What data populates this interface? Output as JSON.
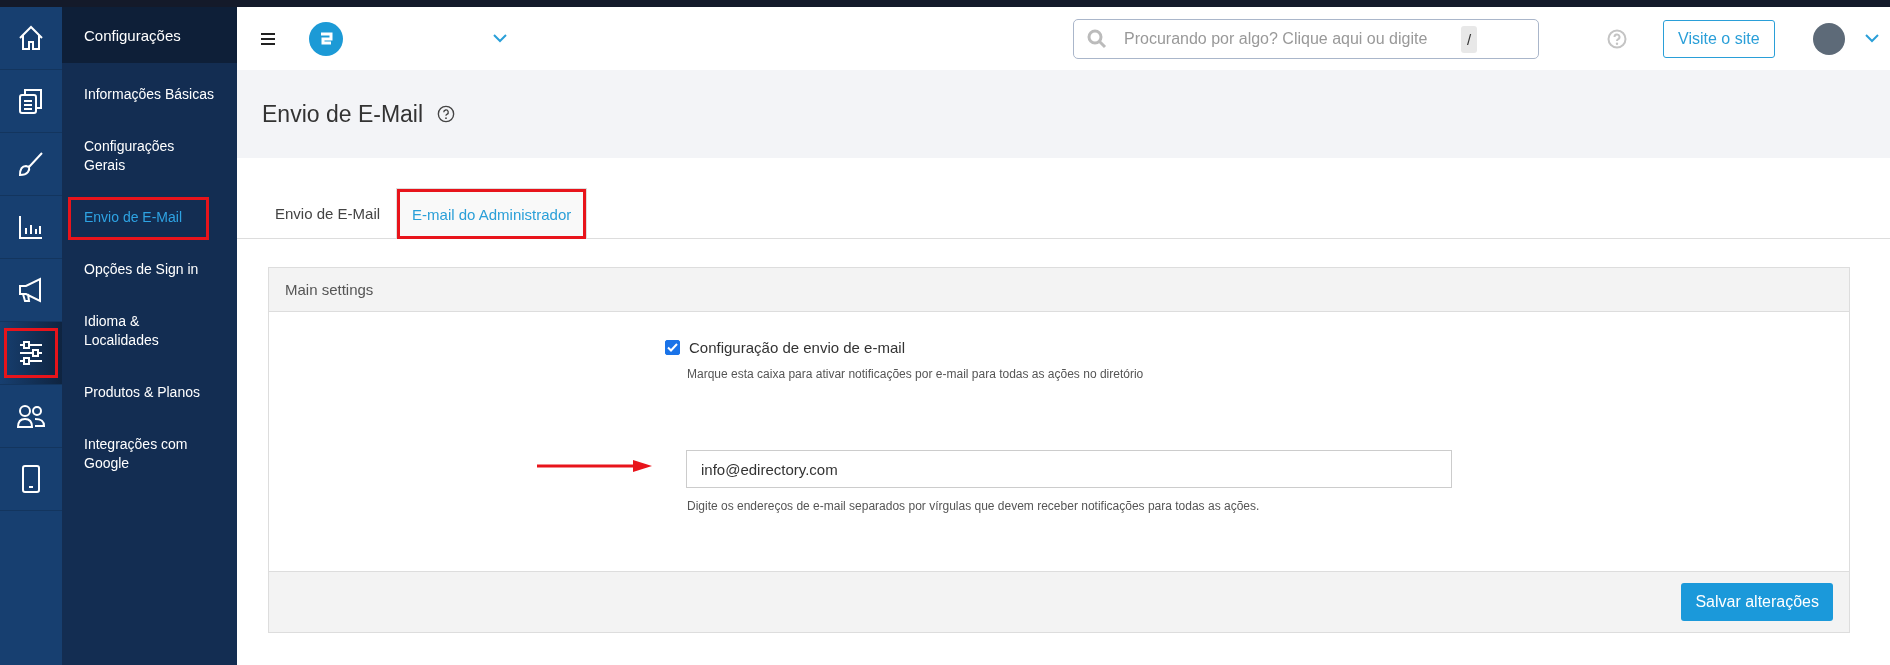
{
  "rail": [
    {
      "kind": "home",
      "selected": false,
      "highlighted": false
    },
    {
      "kind": "pages",
      "selected": false,
      "highlighted": false
    },
    {
      "kind": "brush",
      "selected": false,
      "highlighted": false
    },
    {
      "kind": "chart",
      "selected": false,
      "highlighted": false
    },
    {
      "kind": "megaphone",
      "selected": false,
      "highlighted": false
    },
    {
      "kind": "sliders",
      "selected": true,
      "highlighted": true
    },
    {
      "kind": "users",
      "selected": false,
      "highlighted": false
    },
    {
      "kind": "phone",
      "selected": false,
      "highlighted": false
    }
  ],
  "sidebar": {
    "title": "Configurações",
    "items": [
      {
        "label": "Informações Básicas",
        "selected": false,
        "highlighted": false
      },
      {
        "label": "Configurações Gerais",
        "selected": false,
        "highlighted": false
      },
      {
        "label": "Envio de E-Mail",
        "selected": true,
        "highlighted": true
      },
      {
        "label": "Opções de Sign in",
        "selected": false,
        "highlighted": false
      },
      {
        "label": "Idioma & Localidades",
        "selected": false,
        "highlighted": false
      },
      {
        "label": "Produtos & Planos",
        "selected": false,
        "highlighted": false
      },
      {
        "label": "Integrações com Google",
        "selected": false,
        "highlighted": false
      }
    ]
  },
  "topbar": {
    "search": {
      "placeholder": "Procurando por algo? Clique aqui ou digite",
      "shortcut": "/"
    },
    "visit_button": "Visite o site"
  },
  "page": {
    "title": "Envio de E-Mail"
  },
  "tabs": [
    {
      "label": "Envio de E-Mail",
      "selected": false,
      "highlighted": false
    },
    {
      "label": "E-mail do Administrador",
      "selected": true,
      "highlighted": true
    }
  ],
  "panel": {
    "title": "Main settings",
    "checkbox": {
      "label": "Configuração de envio de e-mail",
      "checked": true,
      "help": "Marque esta caixa para ativar notificações por e-mail para todas as ações no diretório"
    },
    "email_field": {
      "value": "info@edirectory.com",
      "help": "Digite os endereços de e-mail separados por vírgulas que devem receber notificações para todas as ações.",
      "arrow": true
    },
    "save_button": "Salvar alterações"
  }
}
